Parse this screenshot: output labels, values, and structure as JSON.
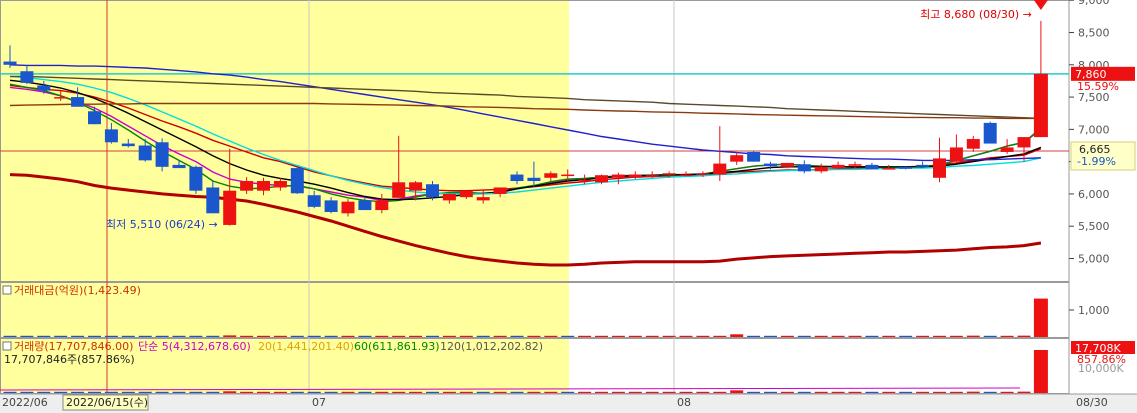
{
  "chart_data": {
    "type": "candlestick",
    "price_axis": {
      "ticks": [
        5000,
        5500,
        6000,
        6500,
        7000,
        7500,
        8000,
        8500,
        9000
      ],
      "tick_labels": [
        "5,000",
        "5,500",
        "6,000",
        "6,500",
        "7,000",
        "7,500",
        "8,000",
        "8,500",
        "9,000"
      ],
      "ylim": [
        4750,
        9000
      ]
    },
    "volume_amount_axis": {
      "ticks": [
        1000
      ],
      "tick_labels": [
        "1,000"
      ]
    },
    "volume_axis": {
      "ticks": [
        10000
      ],
      "tick_labels": [
        "10,000K"
      ]
    },
    "date_labels": [
      "2022/06",
      "07",
      "08",
      "08/30"
    ],
    "cursor_date": "2022/06/15(수)",
    "candles": [
      {
        "o": 8050,
        "h": 8300,
        "l": 7950,
        "c": 8000
      },
      {
        "o": 7900,
        "h": 8000,
        "l": 7700,
        "c": 7720
      },
      {
        "o": 7680,
        "h": 7750,
        "l": 7550,
        "c": 7600
      },
      {
        "o": 7500,
        "h": 7600,
        "l": 7440,
        "c": 7500
      },
      {
        "o": 7500,
        "h": 7650,
        "l": 7380,
        "c": 7350
      },
      {
        "o": 7280,
        "h": 7350,
        "l": 7080,
        "c": 7080
      },
      {
        "o": 7000,
        "h": 7100,
        "l": 6780,
        "c": 6800
      },
      {
        "o": 6780,
        "h": 6850,
        "l": 6720,
        "c": 6740
      },
      {
        "o": 6750,
        "h": 6850,
        "l": 6500,
        "c": 6520
      },
      {
        "o": 6800,
        "h": 6860,
        "l": 6350,
        "c": 6420
      },
      {
        "o": 6450,
        "h": 6520,
        "l": 6400,
        "c": 6400
      },
      {
        "o": 6420,
        "h": 6440,
        "l": 6000,
        "c": 6050
      },
      {
        "o": 6100,
        "h": 6200,
        "l": 5850,
        "c": 5700
      },
      {
        "o": 5520,
        "h": 6700,
        "l": 5510,
        "c": 6050
      },
      {
        "o": 6050,
        "h": 6260,
        "l": 6000,
        "c": 6200
      },
      {
        "o": 6050,
        "h": 6250,
        "l": 5980,
        "c": 6200
      },
      {
        "o": 6100,
        "h": 6250,
        "l": 6050,
        "c": 6200
      },
      {
        "o": 6400,
        "h": 6420,
        "l": 6000,
        "c": 6010
      },
      {
        "o": 5980,
        "h": 6050,
        "l": 5780,
        "c": 5800
      },
      {
        "o": 5900,
        "h": 5950,
        "l": 5700,
        "c": 5720
      },
      {
        "o": 5700,
        "h": 5920,
        "l": 5650,
        "c": 5880
      },
      {
        "o": 5900,
        "h": 5950,
        "l": 5750,
        "c": 5750
      },
      {
        "o": 5750,
        "h": 6000,
        "l": 5700,
        "c": 5900
      },
      {
        "o": 5940,
        "h": 6900,
        "l": 5940,
        "c": 6180
      },
      {
        "o": 6050,
        "h": 6200,
        "l": 5900,
        "c": 6180
      },
      {
        "o": 6150,
        "h": 6200,
        "l": 5900,
        "c": 5950
      },
      {
        "o": 5900,
        "h": 6000,
        "l": 5850,
        "c": 6000
      },
      {
        "o": 5950,
        "h": 6050,
        "l": 5920,
        "c": 6050
      },
      {
        "o": 5900,
        "h": 6050,
        "l": 5850,
        "c": 5950
      },
      {
        "o": 6000,
        "h": 6100,
        "l": 5950,
        "c": 6100
      },
      {
        "o": 6300,
        "h": 6350,
        "l": 6150,
        "c": 6200
      },
      {
        "o": 6250,
        "h": 6500,
        "l": 6100,
        "c": 6200
      },
      {
        "o": 6250,
        "h": 6350,
        "l": 6200,
        "c": 6320
      },
      {
        "o": 6300,
        "h": 6380,
        "l": 6200,
        "c": 6300
      },
      {
        "o": 6200,
        "h": 6300,
        "l": 6150,
        "c": 6220
      },
      {
        "o": 6180,
        "h": 6300,
        "l": 6150,
        "c": 6290
      },
      {
        "o": 6250,
        "h": 6330,
        "l": 6150,
        "c": 6300
      },
      {
        "o": 6250,
        "h": 6350,
        "l": 6230,
        "c": 6300
      },
      {
        "o": 6280,
        "h": 6350,
        "l": 6250,
        "c": 6290
      },
      {
        "o": 6300,
        "h": 6350,
        "l": 6250,
        "c": 6320
      },
      {
        "o": 6300,
        "h": 6350,
        "l": 6270,
        "c": 6300
      },
      {
        "o": 6300,
        "h": 6350,
        "l": 6260,
        "c": 6320
      },
      {
        "o": 6300,
        "h": 7050,
        "l": 6200,
        "c": 6470
      },
      {
        "o": 6500,
        "h": 6650,
        "l": 6450,
        "c": 6600
      },
      {
        "o": 6650,
        "h": 6660,
        "l": 6500,
        "c": 6500
      },
      {
        "o": 6470,
        "h": 6500,
        "l": 6380,
        "c": 6430
      },
      {
        "o": 6420,
        "h": 6480,
        "l": 6400,
        "c": 6480
      },
      {
        "o": 6460,
        "h": 6520,
        "l": 6320,
        "c": 6350
      },
      {
        "o": 6350,
        "h": 6470,
        "l": 6320,
        "c": 6420
      },
      {
        "o": 6400,
        "h": 6500,
        "l": 6380,
        "c": 6450
      },
      {
        "o": 6460,
        "h": 6500,
        "l": 6400,
        "c": 6460
      },
      {
        "o": 6450,
        "h": 6480,
        "l": 6380,
        "c": 6380
      },
      {
        "o": 6400,
        "h": 6450,
        "l": 6380,
        "c": 6400
      },
      {
        "o": 6420,
        "h": 6430,
        "l": 6380,
        "c": 6390
      },
      {
        "o": 6450,
        "h": 6500,
        "l": 6400,
        "c": 6420
      },
      {
        "o": 6250,
        "h": 6870,
        "l": 6180,
        "c": 6550
      },
      {
        "o": 6500,
        "h": 6920,
        "l": 6480,
        "c": 6720
      },
      {
        "o": 6700,
        "h": 6900,
        "l": 6650,
        "c": 6850
      },
      {
        "o": 7100,
        "h": 7120,
        "l": 6780,
        "c": 6780
      },
      {
        "o": 6650,
        "h": 6850,
        "l": 6620,
        "c": 6720
      },
      {
        "o": 6720,
        "h": 6880,
        "l": 6500,
        "c": 6880
      },
      {
        "o": 6880,
        "h": 8680,
        "l": 6880,
        "c": 7860
      }
    ],
    "bar_colors": [
      "blue",
      "blue",
      "blue",
      "blue",
      "blue",
      "blue",
      "blue",
      "blue",
      "blue",
      "blue",
      "blue",
      "blue",
      "blue",
      "red",
      "red",
      "red",
      "red",
      "blue",
      "blue",
      "blue",
      "red",
      "blue",
      "red",
      "red",
      "red",
      "blue",
      "red",
      "red",
      "blue",
      "red",
      "blue",
      "red",
      "red",
      "blue",
      "red",
      "red",
      "red",
      "red",
      "red",
      "red",
      "red",
      "red",
      "red",
      "red",
      "blue",
      "blue",
      "red",
      "blue",
      "red",
      "red",
      "red",
      "blue",
      "red",
      "blue",
      "red",
      "red",
      "red",
      "red",
      "blue",
      "red",
      "red",
      "red"
    ],
    "moving_averages": [
      {
        "color": "#cc0000",
        "values": [
          7680,
          7650,
          7620,
          7600,
          7560,
          7500,
          7420,
          7330,
          7230,
          7130,
          7040,
          6940,
          6830,
          6740,
          6650,
          6560,
          6500,
          6420,
          6340,
          6280,
          6220,
          6170,
          6120,
          6100,
          6080,
          6060,
          6050,
          6050,
          6060,
          6070,
          6090,
          6110,
          6140,
          6170,
          6190,
          6220,
          6240,
          6260,
          6270,
          6280,
          6290,
          6300,
          6320,
          6340,
          6350,
          6360,
          6370,
          6370,
          6380,
          6390,
          6400,
          6400,
          6410,
          6420,
          6430,
          6450,
          6480,
          6520,
          6560,
          6580,
          6600,
          6700
        ]
      },
      {
        "color": "#cc00cc",
        "values": [
          7650,
          7620,
          7580,
          7520,
          7430,
          7330,
          7200,
          7050,
          6900,
          6750,
          6620,
          6500,
          6340,
          6230,
          6180,
          6150,
          6130,
          6120,
          6080,
          6030,
          5980,
          5950,
          5900,
          5920,
          5970,
          6000,
          6010,
          6020,
          6010,
          6020,
          6080,
          6120,
          6180,
          6220,
          6240,
          6260,
          6280,
          6290,
          6290,
          6290,
          6300,
          6300,
          6350,
          6390,
          6430,
          6450,
          6460,
          6440,
          6430,
          6420,
          6420,
          6420,
          6410,
          6410,
          6410,
          6450,
          6520,
          6590,
          6660,
          6740,
          6800,
          7000
        ]
      },
      {
        "color": "#008800",
        "values": [
          7700,
          7650,
          7600,
          7520,
          7420,
          7290,
          7150,
          6990,
          6820,
          6660,
          6520,
          6380,
          6200,
          6120,
          6080,
          6090,
          6120,
          6130,
          6080,
          6000,
          5940,
          5900,
          5880,
          5900,
          5950,
          6000,
          6020,
          6030,
          6000,
          6030,
          6090,
          6130,
          6190,
          6230,
          6240,
          6260,
          6270,
          6290,
          6290,
          6290,
          6300,
          6310,
          6350,
          6390,
          6430,
          6450,
          6460,
          6440,
          6430,
          6420,
          6420,
          6420,
          6410,
          6410,
          6410,
          6450,
          6520,
          6590,
          6660,
          6740,
          6800,
          7020
        ]
      },
      {
        "color": "#000000",
        "values": [
          7760,
          7730,
          7690,
          7640,
          7570,
          7480,
          7370,
          7250,
          7120,
          6990,
          6860,
          6730,
          6590,
          6470,
          6370,
          6290,
          6240,
          6200,
          6150,
          6090,
          6020,
          5960,
          5920,
          5910,
          5920,
          5940,
          5960,
          5990,
          6010,
          6030,
          6080,
          6120,
          6160,
          6200,
          6220,
          6250,
          6270,
          6280,
          6290,
          6300,
          6300,
          6310,
          6330,
          6350,
          6380,
          6410,
          6420,
          6420,
          6420,
          6420,
          6420,
          6420,
          6420,
          6420,
          6420,
          6430,
          6460,
          6500,
          6540,
          6580,
          6620,
          6720
        ]
      },
      {
        "color": "#00dddd",
        "values": [
          7820,
          7800,
          7770,
          7740,
          7700,
          7640,
          7570,
          7480,
          7380,
          7270,
          7160,
          7050,
          6930,
          6820,
          6710,
          6610,
          6520,
          6440,
          6360,
          6280,
          6210,
          6150,
          6100,
          6060,
          6030,
          6010,
          6000,
          6000,
          6000,
          6010,
          6030,
          6060,
          6090,
          6120,
          6150,
          6180,
          6200,
          6220,
          6240,
          6260,
          6270,
          6280,
          6300,
          6310,
          6330,
          6350,
          6360,
          6370,
          6370,
          6380,
          6380,
          6390,
          6390,
          6400,
          6400,
          6410,
          6430,
          6440,
          6460,
          6480,
          6500,
          6560
        ]
      },
      {
        "color": "#2020cc",
        "values": [
          8000,
          7990,
          7990,
          7990,
          7980,
          7980,
          7970,
          7960,
          7950,
          7930,
          7910,
          7890,
          7860,
          7840,
          7810,
          7770,
          7740,
          7700,
          7660,
          7620,
          7580,
          7540,
          7500,
          7460,
          7420,
          7380,
          7340,
          7290,
          7240,
          7190,
          7140,
          7090,
          7040,
          6990,
          6940,
          6890,
          6850,
          6810,
          6770,
          6740,
          6710,
          6680,
          6660,
          6640,
          6620,
          6610,
          6590,
          6580,
          6570,
          6560,
          6550,
          6540,
          6540,
          6530,
          6520,
          6520,
          6520,
          6530,
          6530,
          6540,
          6550,
          6560
        ]
      },
      {
        "color": "#5a4a2a",
        "values": [
          7820,
          7820,
          7810,
          7800,
          7790,
          7780,
          7770,
          7760,
          7750,
          7740,
          7730,
          7720,
          7710,
          7700,
          7690,
          7680,
          7670,
          7660,
          7650,
          7640,
          7630,
          7620,
          7610,
          7600,
          7590,
          7570,
          7560,
          7550,
          7540,
          7530,
          7510,
          7500,
          7490,
          7480,
          7460,
          7450,
          7440,
          7430,
          7420,
          7400,
          7390,
          7380,
          7370,
          7360,
          7350,
          7340,
          7320,
          7310,
          7300,
          7290,
          7280,
          7270,
          7260,
          7250,
          7240,
          7230,
          7220,
          7210,
          7200,
          7190,
          7180,
          7170
        ]
      },
      {
        "color": "#8b3a10",
        "values": [
          7370,
          7375,
          7380,
          7385,
          7390,
          7390,
          7395,
          7395,
          7400,
          7400,
          7400,
          7400,
          7400,
          7400,
          7400,
          7400,
          7400,
          7400,
          7400,
          7395,
          7390,
          7385,
          7380,
          7375,
          7370,
          7365,
          7360,
          7350,
          7345,
          7340,
          7330,
          7320,
          7315,
          7310,
          7300,
          7290,
          7285,
          7280,
          7270,
          7265,
          7260,
          7250,
          7245,
          7240,
          7230,
          7225,
          7220,
          7215,
          7210,
          7205,
          7200,
          7195,
          7190,
          7185,
          7185,
          7180,
          7180,
          7175,
          7175,
          7170,
          7170,
          7170
        ]
      },
      {
        "color": "#b00000",
        "values": [
          6300,
          6290,
          6260,
          6230,
          6190,
          6130,
          6090,
          6060,
          6030,
          6000,
          5980,
          5960,
          5950,
          5920,
          5890,
          5840,
          5780,
          5720,
          5650,
          5580,
          5500,
          5420,
          5340,
          5270,
          5200,
          5140,
          5080,
          5030,
          4990,
          4960,
          4930,
          4910,
          4900,
          4900,
          4910,
          4930,
          4940,
          4950,
          4950,
          4950,
          4950,
          4950,
          4960,
          4990,
          5010,
          5030,
          5040,
          5050,
          5060,
          5070,
          5080,
          5090,
          5100,
          5100,
          5110,
          5120,
          5130,
          5150,
          5170,
          5180,
          5200,
          5240
        ]
      }
    ],
    "amount_values": [
      8,
      6,
      5,
      5,
      7,
      9,
      8,
      6,
      6,
      6,
      7,
      9,
      30,
      60,
      25,
      10,
      8,
      30,
      8,
      6,
      8,
      7,
      8,
      22,
      12,
      10,
      9,
      8,
      8,
      8,
      6,
      9,
      6,
      12,
      12,
      8,
      10,
      9,
      8,
      7,
      6,
      6,
      5,
      100,
      35,
      15,
      15,
      20,
      15,
      10,
      8,
      10,
      10,
      8,
      8,
      8,
      10,
      50,
      35,
      30,
      50,
      1423
    ],
    "volume_values": [
      90,
      70,
      60,
      60,
      80,
      100,
      90,
      70,
      70,
      80,
      90,
      100,
      380,
      700,
      300,
      120,
      100,
      350,
      100,
      70,
      90,
      80,
      100,
      260,
      140,
      110,
      100,
      90,
      90,
      90,
      70,
      100,
      70,
      140,
      140,
      90,
      120,
      100,
      90,
      80,
      70,
      70,
      60,
      1100,
      400,
      180,
      170,
      230,
      170,
      120,
      90,
      110,
      110,
      90,
      90,
      90,
      110,
      560,
      400,
      340,
      560,
      17708
    ],
    "annotations": {
      "high_label": "최고 8,680 (08/30) →",
      "low_label": "최저 5,510 (06/24) →",
      "last_price": "7,860",
      "last_pct": "15.59%",
      "ref_price": "6,665",
      "ref_pct": "-1.99%"
    },
    "amount_panel": {
      "title": "거래대금(억원)(1,423.49)"
    },
    "volume_panel": {
      "legend": [
        "거래량(17,707,846.00)",
        "단순 5(4,312,678.60)",
        "20(1,441,201.40)",
        "60(611,861.93)",
        "120(1,012,202.82)"
      ],
      "line2": "17,707,846주(857.86%)",
      "axis_badge": "17,708K",
      "axis_pct": "857.86%"
    }
  }
}
